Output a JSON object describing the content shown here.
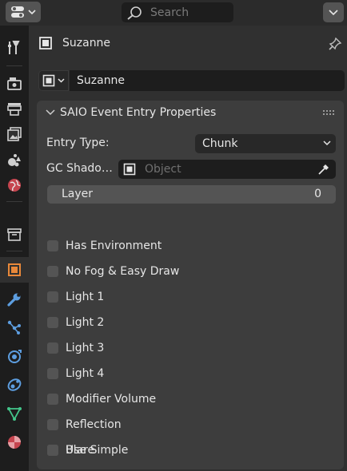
{
  "header": {
    "search_placeholder": "Search"
  },
  "tabs": [
    {
      "name": "tool-tab",
      "icon": "tool-icon",
      "active": false
    },
    {
      "name": "render-tab",
      "icon": "render-camera-icon",
      "active": false
    },
    {
      "name": "output-tab",
      "icon": "output-printer-icon",
      "active": false
    },
    {
      "name": "view-layer-tab",
      "icon": "view-layer-icon",
      "active": false
    },
    {
      "name": "scene-tab",
      "icon": "scene-icon",
      "active": false
    },
    {
      "name": "world-tab",
      "icon": "world-icon",
      "active": false
    },
    {
      "name": "collection-tab",
      "icon": "collection-box-icon",
      "active": false
    },
    {
      "name": "object-tab",
      "icon": "object-icon",
      "active": true
    },
    {
      "name": "modifier-tab",
      "icon": "wrench-icon",
      "active": false
    },
    {
      "name": "particles-tab",
      "icon": "particles-icon",
      "active": false
    },
    {
      "name": "physics-tab",
      "icon": "physics-icon",
      "active": false
    },
    {
      "name": "constraints-tab",
      "icon": "constraint-icon",
      "active": false
    },
    {
      "name": "data-tab",
      "icon": "mesh-data-icon",
      "active": false
    },
    {
      "name": "material-tab",
      "icon": "material-icon",
      "active": false
    }
  ],
  "context": {
    "title": "Suzanne",
    "datablock_name": "Suzanne"
  },
  "panel": {
    "title": "SAIO Event Entry Properties",
    "entry_type_label": "Entry Type:",
    "entry_type_value": "Chunk",
    "gc_shadow_label": "GC Shado…",
    "gc_shadow_placeholder": "Object",
    "layer_label": "Layer",
    "layer_value": "0",
    "checkboxes": [
      {
        "label": "Has Environment",
        "checked": false
      },
      {
        "label": "No Fog & Easy Draw",
        "checked": false
      },
      {
        "label": "Light 1",
        "checked": false
      },
      {
        "label": "Light 2",
        "checked": false
      },
      {
        "label": "Light 3",
        "checked": false
      },
      {
        "label": "Light 4",
        "checked": false
      },
      {
        "label": "Modifier Volume",
        "checked": false
      },
      {
        "label": "Reflection",
        "checked": false
      },
      {
        "label": "Blare",
        "checked": false
      },
      {
        "label": "Use Simple",
        "checked": false
      }
    ]
  },
  "colors": {
    "object_accent": "#e8883a",
    "modifier_blue": "#5d9ee0",
    "data_green": "#43c68b",
    "world_red": "#c6454f",
    "panel_bg": "#3d3d3d"
  }
}
